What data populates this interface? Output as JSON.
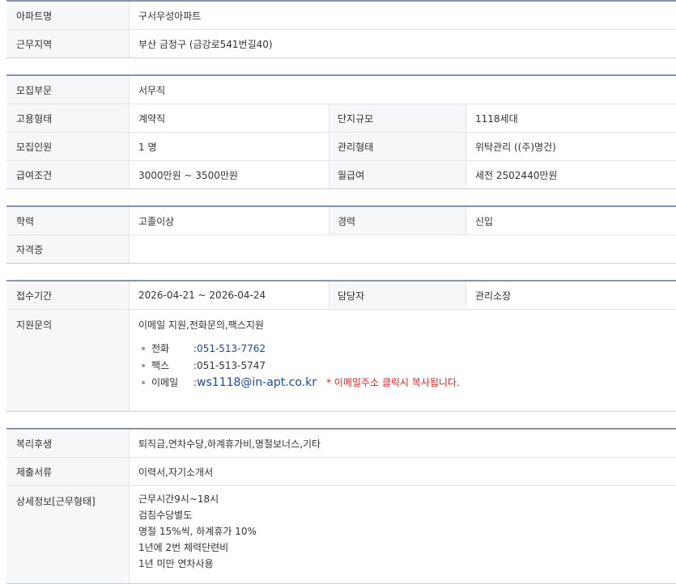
{
  "apt": {
    "name_label": "아파트명",
    "name_value": "구서우성아파트",
    "region_label": "근무지역",
    "region_value": "부산  금정구 (금강로541번길40)"
  },
  "recruit": {
    "dept_label": "모집부문",
    "dept_value": "서무직",
    "employ_label": "고용형태",
    "employ_value": "계약직",
    "scale_label": "단지규모",
    "scale_value": "1118세대",
    "count_label": "모집인원",
    "count_value": "1 명",
    "manage_label": "관리형태",
    "manage_value": "위탁관리 ((주)명건)",
    "salary_label": "급여조건",
    "salary_value": "3000만원 ~ 3500만원",
    "monthly_label": "월급여",
    "monthly_value": "세전 2502440만원"
  },
  "qual": {
    "edu_label": "학력",
    "edu_value": "고졸이상",
    "career_label": "경력",
    "career_value": "신입",
    "cert_label": "자격증",
    "cert_value": ""
  },
  "apply": {
    "period_label": "접수기간",
    "period_value": "2026-04-21 ~ 2026-04-24",
    "manager_label": "담당자",
    "manager_value": "관리소장",
    "inquiry_label": "지원문의",
    "inquiry_value": "이메일 지원,전화문의,팩스지원",
    "contacts": [
      {
        "label": "전화",
        "value": ":051-513-7762"
      },
      {
        "label": "팩스",
        "value": ":051-513-5747"
      }
    ],
    "email_label": "이메일",
    "email_colon": ":",
    "email_value": "ws1118@in-apt.co.kr",
    "email_note": "* 이메일주소 클릭시 복사됩니다."
  },
  "welfare": {
    "benefit_label": "복리후생",
    "benefit_value": "퇴직금,연차수당,하계휴가비,명절보너스,기타",
    "docs_label": "제출서류",
    "docs_value": "이력서,자기소개서",
    "detail_label": "상세정보[근무형태]",
    "detail_lines": [
      "근무시간9시~18시",
      "검침수당별도",
      "명절 15%씩, 하계휴가 10%",
      "1년에 2번 체력단련비",
      "1년 미만 연차사용"
    ]
  }
}
